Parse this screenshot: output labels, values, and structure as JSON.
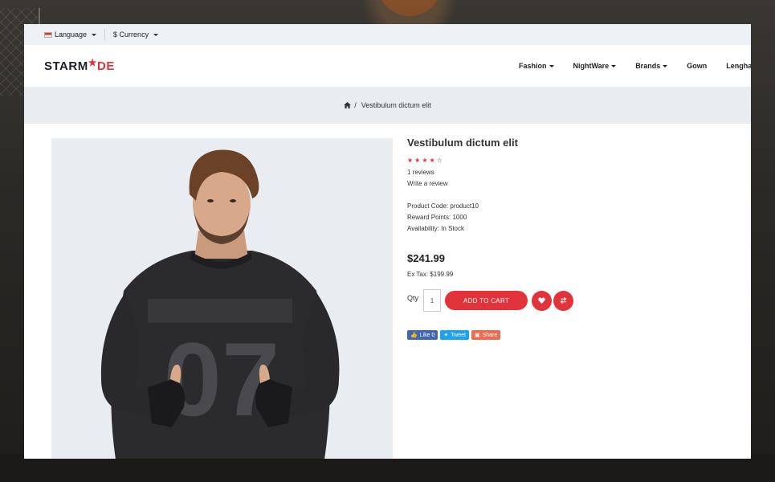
{
  "topbar": {
    "language": "Language",
    "currency": "$ Currency"
  },
  "logo": {
    "part1": "STARM",
    "star": "★",
    "part2": "DE"
  },
  "nav": [
    "Fashion",
    "NightWare",
    "Brands",
    "Gown",
    "Lenghas"
  ],
  "breadcrumb": {
    "current": "Vestibulum dictum elit"
  },
  "product": {
    "title": "Vestibulum dictum elit",
    "rating": 4,
    "max_rating": 5,
    "reviews": "1 reviews",
    "write_review": "Write a review",
    "code": "Product Code: product10",
    "reward": "Reward Points: 1000",
    "availability": "Availability: In Stock",
    "price": "$241.99",
    "ex_tax": "Ex Tax: $199.99",
    "qty_label": "Qty",
    "qty": "1",
    "add_to_cart": "ADD TO CART",
    "jersey_number": "07"
  },
  "social": {
    "like": "Like 0",
    "tweet": "Tweet",
    "share": "Share"
  },
  "colors": {
    "accent": "#e3333a"
  }
}
